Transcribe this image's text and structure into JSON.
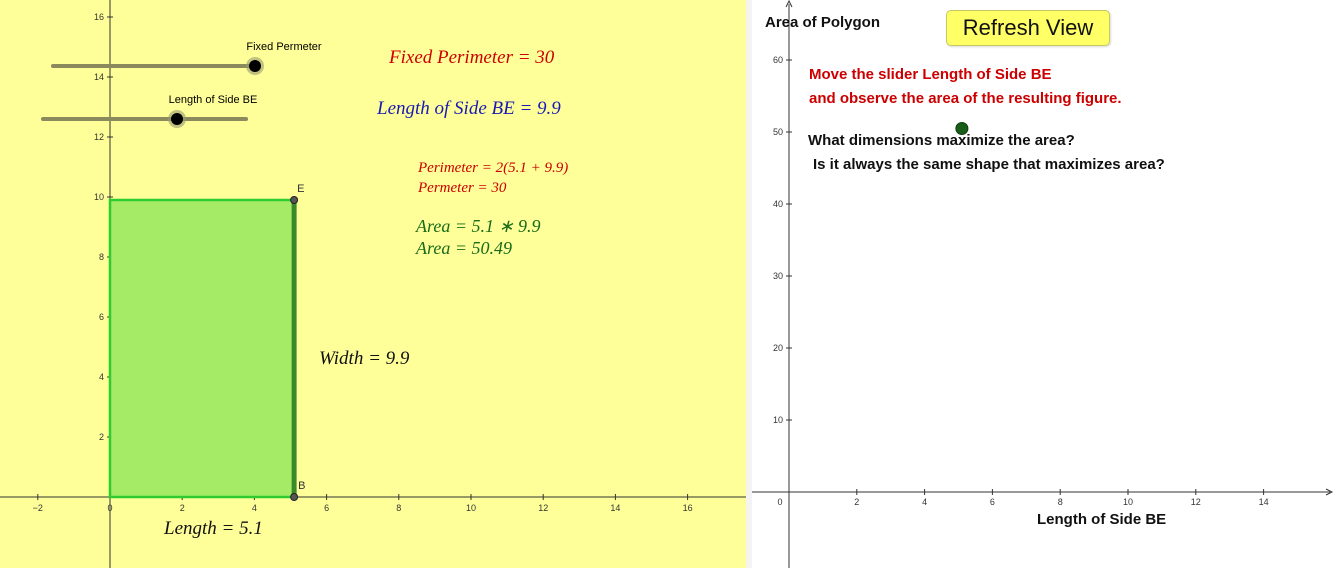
{
  "left": {
    "x_ticks": [
      "−2",
      "0",
      "2",
      "4",
      "6",
      "8",
      "10",
      "12",
      "14",
      "16"
    ],
    "y_ticks": [
      "2",
      "4",
      "6",
      "8",
      "10",
      "12",
      "14",
      "16"
    ],
    "sliders": [
      {
        "label": "Fixed Permeter",
        "value": 30
      },
      {
        "label": "Length of Side BE",
        "value": 9.9
      }
    ],
    "point_labels": {
      "e": "E",
      "b": "B"
    },
    "texts": {
      "fixed_perimeter": "Fixed Perimeter = 30",
      "length_of_side": "Length of Side BE = 9.9",
      "perimeter_formula": "Perimeter = 2(5.1 + 9.9)",
      "perimeter_value": "Permeter = 30",
      "area_formula": "Area = 5.1 ∗ 9.9",
      "area_value": "Area = 50.49",
      "width": "Width = 9.9",
      "length": "Length = 5.1"
    },
    "rectangle": {
      "length": 5.1,
      "width": 9.9
    }
  },
  "right": {
    "title": "Area of Polygon",
    "refresh_button": "Refresh View",
    "instruction_line1": "Move the slider Length of Side BE",
    "instruction_line2": "and observe the area of the resulting figure.",
    "question1": "What dimensions maximize the area?",
    "question2": "Is it always the same shape that maximizes area?",
    "x_axis_label": "Length of Side BE",
    "x_ticks": [
      "0",
      "2",
      "4",
      "6",
      "8",
      "10",
      "12",
      "14"
    ],
    "y_ticks": [
      "10",
      "20",
      "30",
      "40",
      "50",
      "60"
    ],
    "plotted_point": {
      "x": 5.1,
      "y": 50.49
    }
  },
  "colors": {
    "left_background": "#ffff99",
    "rectangle_fill": "#a6eb66",
    "rectangle_stroke": "#2fcc2f",
    "side_be": "#3a8a2a",
    "point": "#1a5c1a",
    "red_text": "#cc0000",
    "blue_text": "#1a1ab3",
    "green_text": "#1a6b1a"
  }
}
